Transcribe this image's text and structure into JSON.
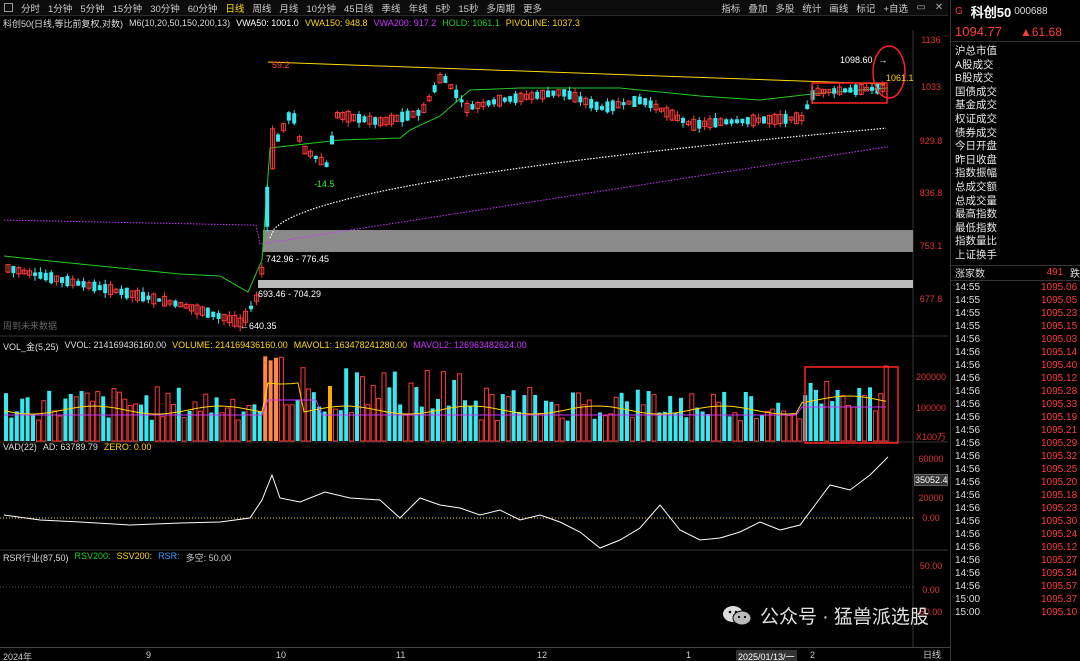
{
  "toolbar": {
    "periods": [
      "分时",
      "1分钟",
      "5分钟",
      "15分钟",
      "30分钟",
      "60分钟",
      "日线",
      "周线",
      "月线",
      "10分钟",
      "45日线",
      "季线",
      "年线",
      "5秒",
      "15秒",
      "多周期",
      "更多"
    ],
    "active_period": "日线",
    "tools": [
      "指标",
      "叠加",
      "多股",
      "统计",
      "画线",
      "标记",
      "+自选"
    ]
  },
  "info": {
    "title": "科创50(日线,等比前复权,对数)",
    "m6": "M6(10,20,50,150,200,13)",
    "vwa50": "VWA50: 1001.0",
    "vwa150": "VWA150: 948.8",
    "vwa200": "VWA200: 917.2",
    "hold": "HOLD: 1061.1",
    "pivoline": "PIVOLINE: 1037.3"
  },
  "colors": {
    "up": "#ff3a3a",
    "down": "#38e8f0",
    "vwa50": "#ffffff",
    "vwa150": "#ffd700",
    "vwa200": "#cc33ff",
    "hold": "#22cc22"
  },
  "main": {
    "y_labels": [
      "1136",
      "1033",
      "929.8",
      "836.8",
      "753.1",
      "677.8"
    ],
    "annotations": {
      "high_left": "59.2",
      "low_mid": "-14.5",
      "range_upper": "742.96 - 776.45",
      "range_lower": "693.46 - 704.29",
      "low_point": "640.35",
      "high_right": "1098.60",
      "hold_value": "1061.1",
      "future_note": "周到未来数据"
    }
  },
  "vol": {
    "title": "VOL_金(5,25)",
    "vvol": "VVOL: 214169436160.00",
    "volume": "VOLUME: 214169436160.00",
    "mavol1": "MAVOL1: 163478241280.00",
    "mavol2": "MAVOL2: 126963482624.00",
    "y_labels": [
      "200000",
      "100000"
    ],
    "unit": "X100万"
  },
  "vad": {
    "title": "VAD(22)",
    "ad": "AD: 63789.79",
    "zero": "ZERO: 0.00",
    "y_labels": [
      "60000",
      "20000",
      "0.00"
    ],
    "current": "35052.4"
  },
  "rsr": {
    "title": "RSR行业(87,50)",
    "rsv": "RSV200:",
    "ssv": "SSV200:",
    "rsr": "RSR:",
    "duokong": "多空: 50.00",
    "y_labels": [
      "50.00",
      "0.00",
      "50.00"
    ]
  },
  "dates": {
    "labels": [
      "2024年",
      "9",
      "10",
      "11",
      "12",
      "1",
      "2025/01/13/一",
      "2"
    ],
    "period": "日线"
  },
  "rpanel": {
    "mark": "G",
    "name": "科创50",
    "code": "000688",
    "price": "1094.77",
    "change": "▲61.68",
    "items": [
      "沪总市值",
      "A股成交",
      "B股成交",
      "国债成交",
      "基金成交",
      "权证成交",
      "债券成交",
      "今日开盘",
      "昨日收盘",
      "指数振幅",
      "总成交额",
      "总成交量",
      "最高指数",
      "最低指数",
      "指数量比",
      "上证换手"
    ],
    "count_label": "涨家数",
    "count_value": "491",
    "count_sub": "跌",
    "ticks": [
      {
        "t": "14:55",
        "v": "1095.06"
      },
      {
        "t": "14:55",
        "v": "1095.05"
      },
      {
        "t": "14:55",
        "v": "1095.23"
      },
      {
        "t": "14:55",
        "v": "1095.15"
      },
      {
        "t": "14:56",
        "v": "1095.03"
      },
      {
        "t": "14:56",
        "v": "1095.14"
      },
      {
        "t": "14:56",
        "v": "1095.40"
      },
      {
        "t": "14:56",
        "v": "1095.12"
      },
      {
        "t": "14:56",
        "v": "1095.28"
      },
      {
        "t": "14:56",
        "v": "1095.33"
      },
      {
        "t": "14:56",
        "v": "1095.19"
      },
      {
        "t": "14:56",
        "v": "1095.21"
      },
      {
        "t": "14:56",
        "v": "1095.29"
      },
      {
        "t": "14:56",
        "v": "1095.32"
      },
      {
        "t": "14:56",
        "v": "1095.25"
      },
      {
        "t": "14:56",
        "v": "1095.20"
      },
      {
        "t": "14:56",
        "v": "1095.18"
      },
      {
        "t": "14:56",
        "v": "1095.23"
      },
      {
        "t": "14:56",
        "v": "1095.30"
      },
      {
        "t": "14:56",
        "v": "1095.24"
      },
      {
        "t": "14:56",
        "v": "1095.12"
      },
      {
        "t": "14:56",
        "v": "1095.27"
      },
      {
        "t": "14:56",
        "v": "1095.34"
      },
      {
        "t": "14:56",
        "v": "1095.57"
      },
      {
        "t": "15:00",
        "v": "1095.37"
      },
      {
        "t": "15:00",
        "v": "1095.10"
      }
    ]
  },
  "watermark": {
    "text": "公众号 · 猛兽派选股"
  }
}
